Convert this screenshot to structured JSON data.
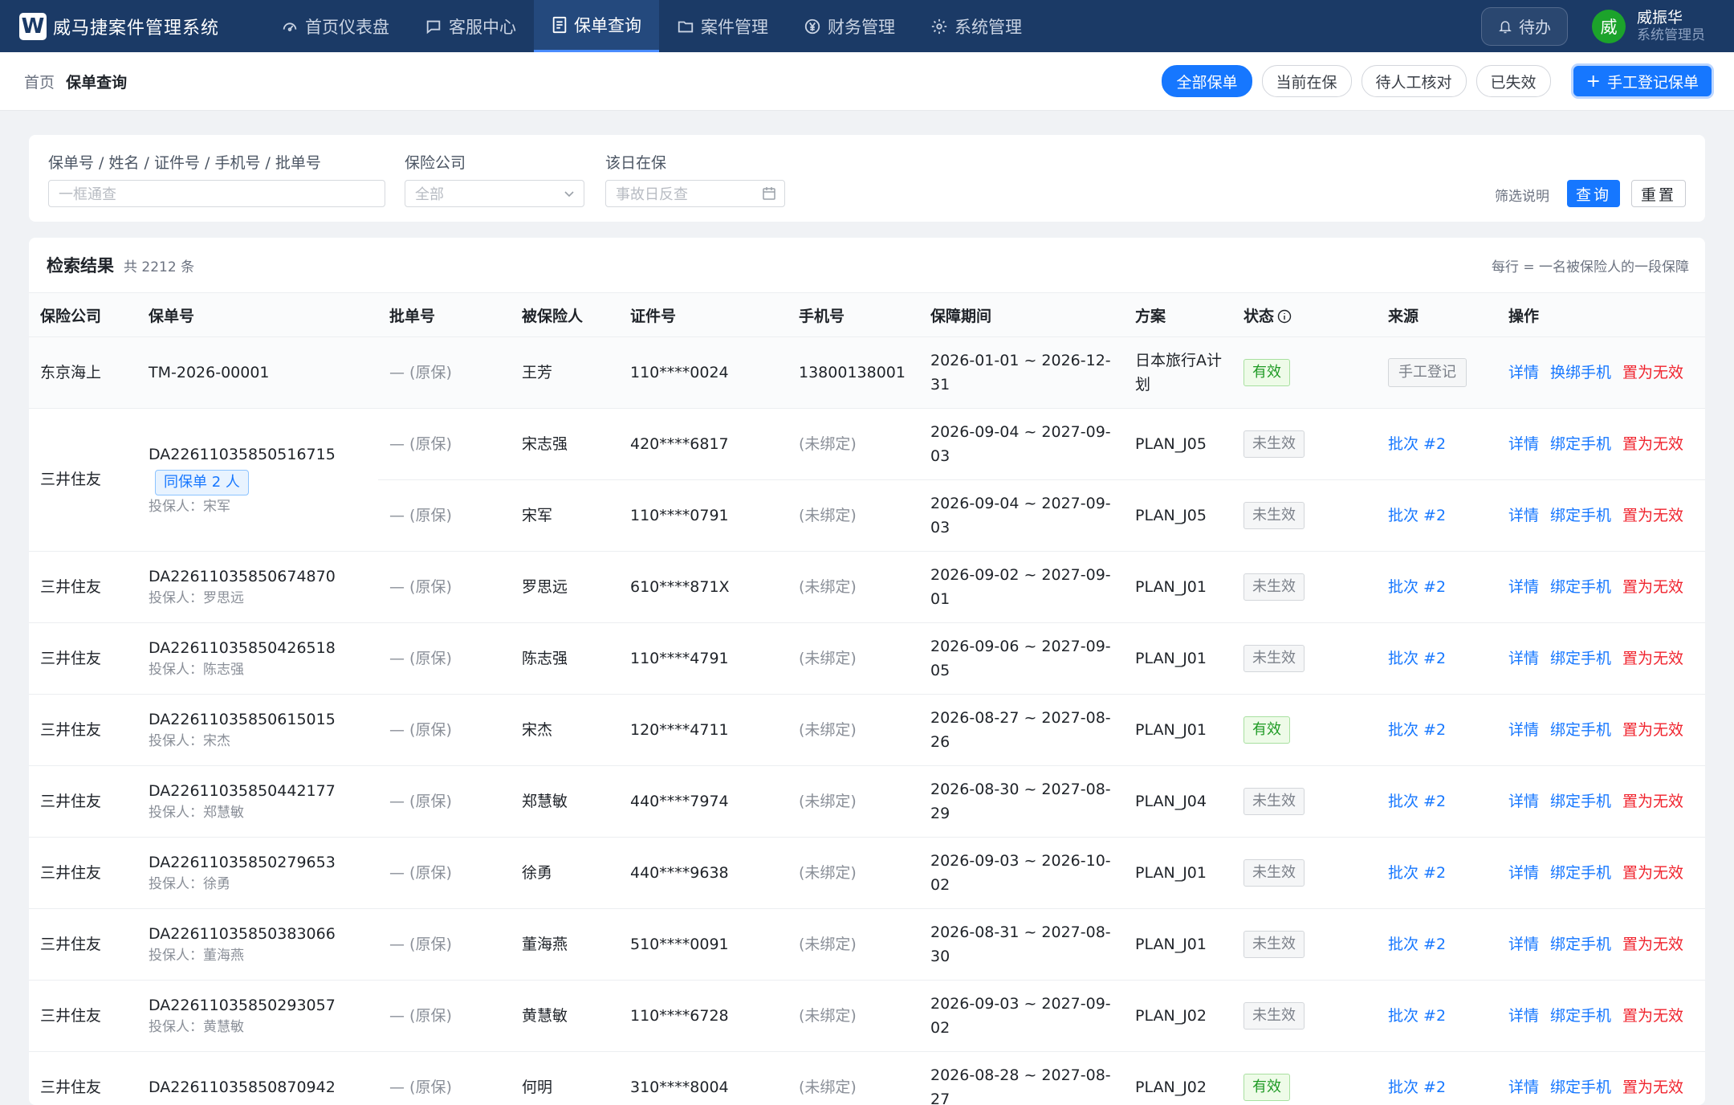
{
  "app": {
    "logo_letter": "W",
    "title": "威马捷案件管理系统"
  },
  "nav": [
    {
      "label": "首页仪表盘",
      "icon": "dashboard-icon",
      "active": false
    },
    {
      "label": "客服中心",
      "icon": "chat-icon",
      "active": false
    },
    {
      "label": "保单查询",
      "icon": "document-icon",
      "active": true
    },
    {
      "label": "案件管理",
      "icon": "folder-icon",
      "active": false
    },
    {
      "label": "财务管理",
      "icon": "yen-icon",
      "active": false
    },
    {
      "label": "系统管理",
      "icon": "gear-icon",
      "active": false
    }
  ],
  "topright": {
    "todo_label": "待办",
    "avatar_letter": "威",
    "user_name": "威振华",
    "user_role": "系统管理员"
  },
  "breadcrumb": {
    "home": "首页",
    "current": "保单查询"
  },
  "segments": [
    {
      "label": "全部保单",
      "active": true
    },
    {
      "label": "当前在保",
      "active": false
    },
    {
      "label": "待人工核对",
      "active": false
    },
    {
      "label": "已失效",
      "active": false
    }
  ],
  "manual_button": {
    "plus": "+",
    "label": "手工登记保单"
  },
  "filters": {
    "keyword": {
      "label": "保单号 / 姓名 / 证件号 / 手机号 / 批单号",
      "placeholder": "一框通查"
    },
    "company": {
      "label": "保险公司",
      "value": "全部"
    },
    "date": {
      "label": "该日在保",
      "placeholder": "事故日反查"
    },
    "help": "筛选说明",
    "query": "查询",
    "reset": "重置"
  },
  "results": {
    "title": "检索结果",
    "count": "共 2212 条",
    "note": "每行 = 一名被保险人的一段保障",
    "columns": [
      "保险公司",
      "保单号",
      "批单号",
      "被保险人",
      "证件号",
      "手机号",
      "保障期间",
      "方案",
      "状态",
      "来源",
      "操作"
    ],
    "same_policy_tag": "同保单 2 人",
    "policyholder_prefix": "投保人：",
    "original_text": "— (原保)",
    "unbound_text": "(未绑定)",
    "row1": {
      "company": "东京海上",
      "policy": "TM-2026-00001",
      "endorsement": "— (原保)",
      "insured": "王芳",
      "id": "110****0024",
      "phone": "13800138001",
      "period": "2026-01-01 ~ 2026-12-31",
      "plan": "日本旅行A计划",
      "status": "有效",
      "source": "手工登记",
      "ops": [
        "详情",
        "换绑手机",
        "置为无效"
      ]
    },
    "group": {
      "company": "三井住友",
      "policy": "DA22611035850516715",
      "holder": "投保人：宋军",
      "members": [
        {
          "endorsement": "— (原保)",
          "insured": "宋志强",
          "id": "420****6817",
          "phone": "(未绑定)",
          "period": "2026-09-04 ~ 2027-09-03",
          "plan": "PLAN_J05",
          "status": "未生效",
          "source": "批次 #2"
        },
        {
          "endorsement": "— (原保)",
          "insured": "宋军",
          "id": "110****0791",
          "phone": "(未绑定)",
          "period": "2026-09-04 ~ 2027-09-03",
          "plan": "PLAN_J05",
          "status": "未生效",
          "source": "批次 #2"
        }
      ]
    },
    "rows": [
      {
        "company": "三井住友",
        "policy": "DA22611035850674870",
        "holder": "投保人：罗思远",
        "endorsement": "— (原保)",
        "insured": "罗思远",
        "id": "610****871X",
        "phone": "(未绑定)",
        "period": "2026-09-02 ~ 2027-09-01",
        "plan": "PLAN_J01",
        "status": "未生效",
        "source": "批次 #2"
      },
      {
        "company": "三井住友",
        "policy": "DA22611035850426518",
        "holder": "投保人：陈志强",
        "endorsement": "— (原保)",
        "insured": "陈志强",
        "id": "110****4791",
        "phone": "(未绑定)",
        "period": "2026-09-06 ~ 2027-09-05",
        "plan": "PLAN_J01",
        "status": "未生效",
        "source": "批次 #2"
      },
      {
        "company": "三井住友",
        "policy": "DA22611035850615015",
        "holder": "投保人：宋杰",
        "endorsement": "— (原保)",
        "insured": "宋杰",
        "id": "120****4711",
        "phone": "(未绑定)",
        "period": "2026-08-27 ~ 2027-08-26",
        "plan": "PLAN_J01",
        "status": "有效",
        "source": "批次 #2"
      },
      {
        "company": "三井住友",
        "policy": "DA22611035850442177",
        "holder": "投保人：郑慧敏",
        "endorsement": "— (原保)",
        "insured": "郑慧敏",
        "id": "440****7974",
        "phone": "(未绑定)",
        "period": "2026-08-30 ~ 2027-08-29",
        "plan": "PLAN_J04",
        "status": "未生效",
        "source": "批次 #2"
      },
      {
        "company": "三井住友",
        "policy": "DA22611035850279653",
        "holder": "投保人：徐勇",
        "endorsement": "— (原保)",
        "insured": "徐勇",
        "id": "440****9638",
        "phone": "(未绑定)",
        "period": "2026-09-03 ~ 2026-10-02",
        "plan": "PLAN_J01",
        "status": "未生效",
        "source": "批次 #2"
      },
      {
        "company": "三井住友",
        "policy": "DA22611035850383066",
        "holder": "投保人：董海燕",
        "endorsement": "— (原保)",
        "insured": "董海燕",
        "id": "510****0091",
        "phone": "(未绑定)",
        "period": "2026-08-31 ~ 2027-08-30",
        "plan": "PLAN_J01",
        "status": "未生效",
        "source": "批次 #2"
      },
      {
        "company": "三井住友",
        "policy": "DA22611035850293057",
        "holder": "投保人：黄慧敏",
        "endorsement": "— (原保)",
        "insured": "黄慧敏",
        "id": "110****6728",
        "phone": "(未绑定)",
        "period": "2026-09-03 ~ 2027-09-02",
        "plan": "PLAN_J02",
        "status": "未生效",
        "source": "批次 #2"
      },
      {
        "company": "三井住友",
        "policy": "DA22611035850870942",
        "holder": "",
        "endorsement": "— (原保)",
        "insured": "何明",
        "id": "310****8004",
        "phone": "(未绑定)",
        "period": "2026-08-28 ~ 2027-08-27",
        "plan": "PLAN_J02",
        "status": "有效",
        "source": "批次 #2"
      }
    ],
    "ops": [
      "详情",
      "绑定手机",
      "置为无效"
    ]
  },
  "colors": {
    "topbar": "#1b3a66",
    "primary": "#1677ff",
    "danger": "#f0232d",
    "ok": "#1e9a24"
  }
}
